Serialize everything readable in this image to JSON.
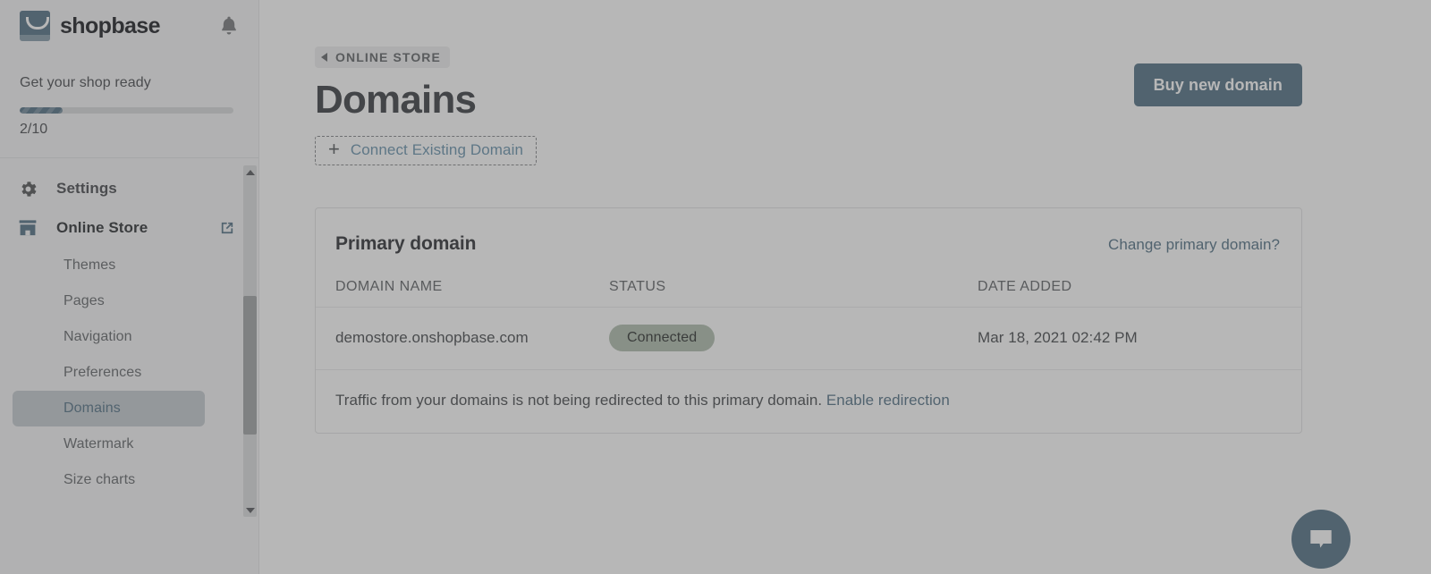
{
  "sidebar": {
    "brand": "shopbase",
    "notification_icon": "bell-icon",
    "shop_ready": {
      "title": "Get your shop ready",
      "progress_label": "2/10",
      "progress_current": 2,
      "progress_total": 10,
      "progress_percent": 20,
      "accent_color": "#1878b9"
    },
    "sections": [
      {
        "label": "Settings",
        "icon": "gear-icon",
        "icon_color": "#4a5159"
      },
      {
        "label": "Online Store",
        "icon": "storefront-icon",
        "icon_color": "#1878b9",
        "external_link_icon": "external-link-icon"
      }
    ],
    "items": [
      {
        "label": "Themes",
        "active": false
      },
      {
        "label": "Pages",
        "active": false
      },
      {
        "label": "Navigation",
        "active": false
      },
      {
        "label": "Preferences",
        "active": false
      },
      {
        "label": "Domains",
        "active": true
      },
      {
        "label": "Watermark",
        "active": false
      },
      {
        "label": "Size charts",
        "active": false
      }
    ],
    "scrollbar": {
      "up_icon": "caret-up-icon",
      "down_icon": "caret-down-icon"
    }
  },
  "header": {
    "breadcrumb": "ONLINE STORE",
    "breadcrumb_icon": "chevron-left-icon",
    "title": "Domains",
    "connect_button": "Connect Existing Domain",
    "connect_icon": "plus-icon",
    "buy_button": "Buy new domain"
  },
  "card": {
    "title": "Primary domain",
    "change_link": "Change primary domain?",
    "columns": [
      "DOMAIN NAME",
      "STATUS",
      "DATE ADDED"
    ],
    "rows": [
      {
        "domain": "demostore.onshopbase.com",
        "status": "Connected",
        "status_color": "#97c695",
        "date_added": "Mar 18, 2021 02:42 PM"
      }
    ],
    "footer_text": "Traffic from your domains is not being redirected to this primary domain.",
    "footer_link": "Enable redirection"
  },
  "chat": {
    "icon": "chat-bubble-icon",
    "color": "#1878b9"
  }
}
